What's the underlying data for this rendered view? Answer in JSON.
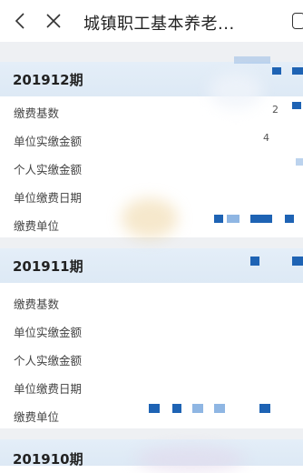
{
  "header": {
    "back_icon": "chevron-left-icon",
    "close_icon": "close-icon",
    "title": "城镇职工基本养老..."
  },
  "periods": [
    {
      "title": "201912期",
      "rows": [
        {
          "label": "缴费基数",
          "value": "2"
        },
        {
          "label": "单位实缴金额",
          "value": "4"
        },
        {
          "label": "个人实缴金额",
          "value": ""
        },
        {
          "label": "单位缴费日期",
          "value": ""
        },
        {
          "label": "缴费单位",
          "value": ""
        }
      ]
    },
    {
      "title": "201911期",
      "rows": [
        {
          "label": "缴费基数",
          "value": ""
        },
        {
          "label": "单位实缴金额",
          "value": ""
        },
        {
          "label": "个人实缴金额",
          "value": ""
        },
        {
          "label": "单位缴费日期",
          "value": ""
        },
        {
          "label": "缴费单位",
          "value": ""
        }
      ]
    },
    {
      "title": "201910期",
      "rows": []
    }
  ],
  "colors": {
    "header_bg": "#e4eef8",
    "accent": "#1e63b4",
    "gap": "#eef0f3"
  }
}
